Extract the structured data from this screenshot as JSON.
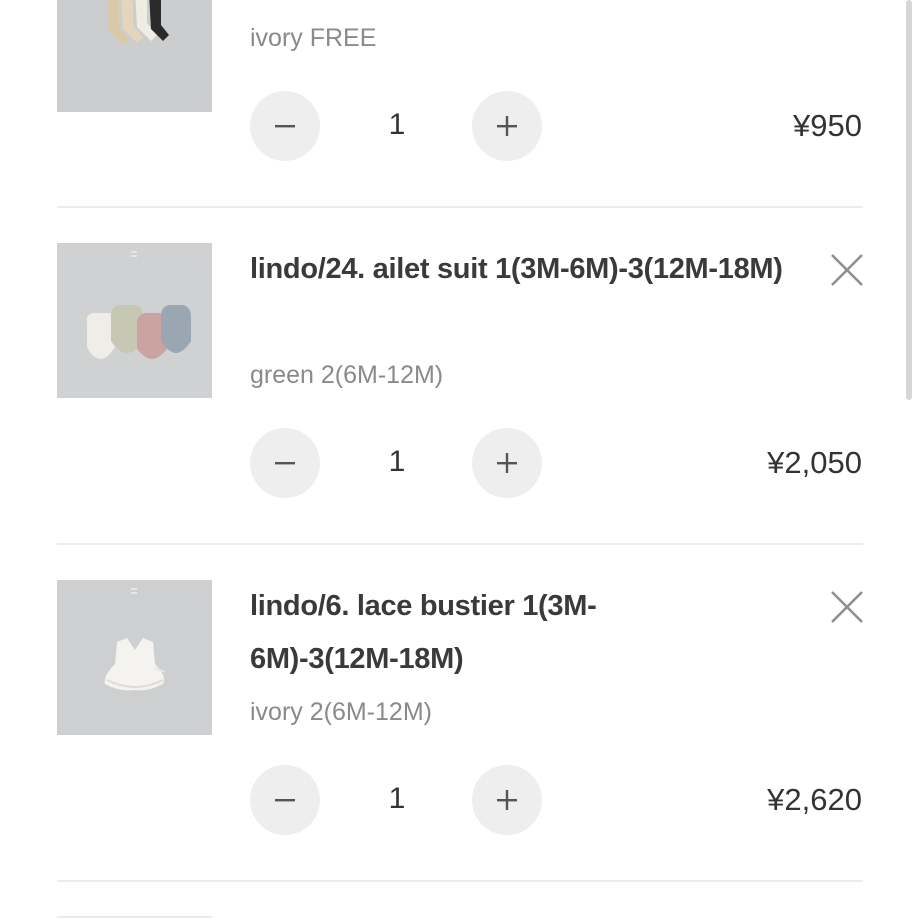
{
  "cart": {
    "items": [
      {
        "variant": "ivory FREE",
        "quantity": "1",
        "price": "¥950"
      },
      {
        "title": "lindo/24. ailet suit 1(3M-6M)-3(12M-18M)",
        "variant": "green 2(6M-12M)",
        "quantity": "1",
        "price": "¥2,050"
      },
      {
        "title": "lindo/6. lace bustier 1(3M-6M)-3(12M-18M)",
        "variant": "ivory 2(6M-12M)",
        "quantity": "1",
        "price": "¥2,620"
      }
    ]
  },
  "icons": {
    "decrease": "minus-icon",
    "increase": "plus-icon",
    "remove": "close-icon"
  },
  "colors": {
    "button_bg": "#eeeeee",
    "text": "#333333",
    "muted_text": "#8a8a8a",
    "divider": "#ececec"
  }
}
